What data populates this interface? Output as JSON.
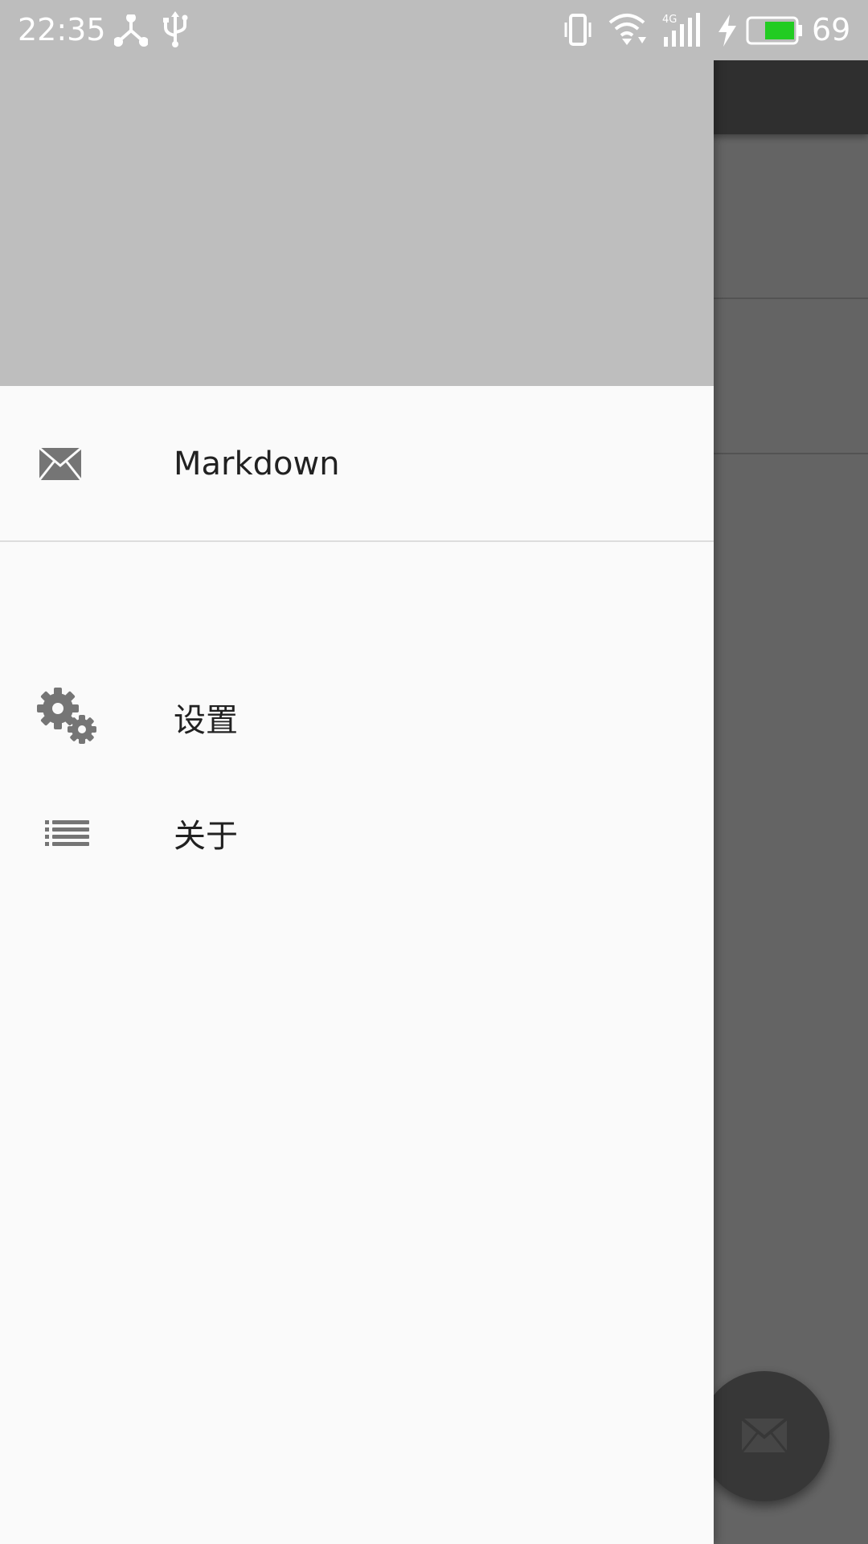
{
  "status_bar": {
    "time": "22:35",
    "battery_percent": "69",
    "left_icons": [
      "hub-icon",
      "usb-icon"
    ],
    "right_icons": [
      "vibrate-icon",
      "wifi-icon",
      "signal-4g-icon",
      "charging-icon",
      "battery-icon"
    ],
    "battery_fill_color": "#22cc22"
  },
  "drawer": {
    "header_color": "#bebebe",
    "items": [
      {
        "label": "Markdown",
        "icon": "mail-icon"
      },
      {
        "label": "设置",
        "icon": "settings-icon"
      },
      {
        "label": "关于",
        "icon": "list-icon"
      }
    ]
  },
  "background_app": {
    "fab_icon": "mail-icon"
  }
}
